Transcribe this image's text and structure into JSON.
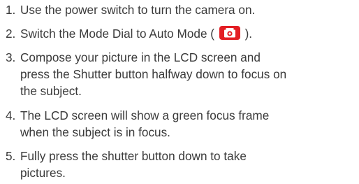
{
  "steps": [
    {
      "number": "1.",
      "lines": [
        "Use the power switch to turn the camera on."
      ]
    },
    {
      "number": "2.",
      "text_before_icon": "Switch the Mode Dial to Auto Mode (",
      "icon": "camera-icon",
      "icon_color": "#e31e24",
      "text_after_icon": ")."
    },
    {
      "number": "3.",
      "lines": [
        "Compose your picture in the LCD screen and",
        "press the Shutter button halfway down to focus on",
        "the subject."
      ]
    },
    {
      "number": "4.",
      "lines": [
        "The LCD screen will show a green focus frame",
        "when the subject is in focus."
      ]
    },
    {
      "number": "5.",
      "lines": [
        "Fully press the shutter button down to take",
        "pictures."
      ]
    }
  ]
}
